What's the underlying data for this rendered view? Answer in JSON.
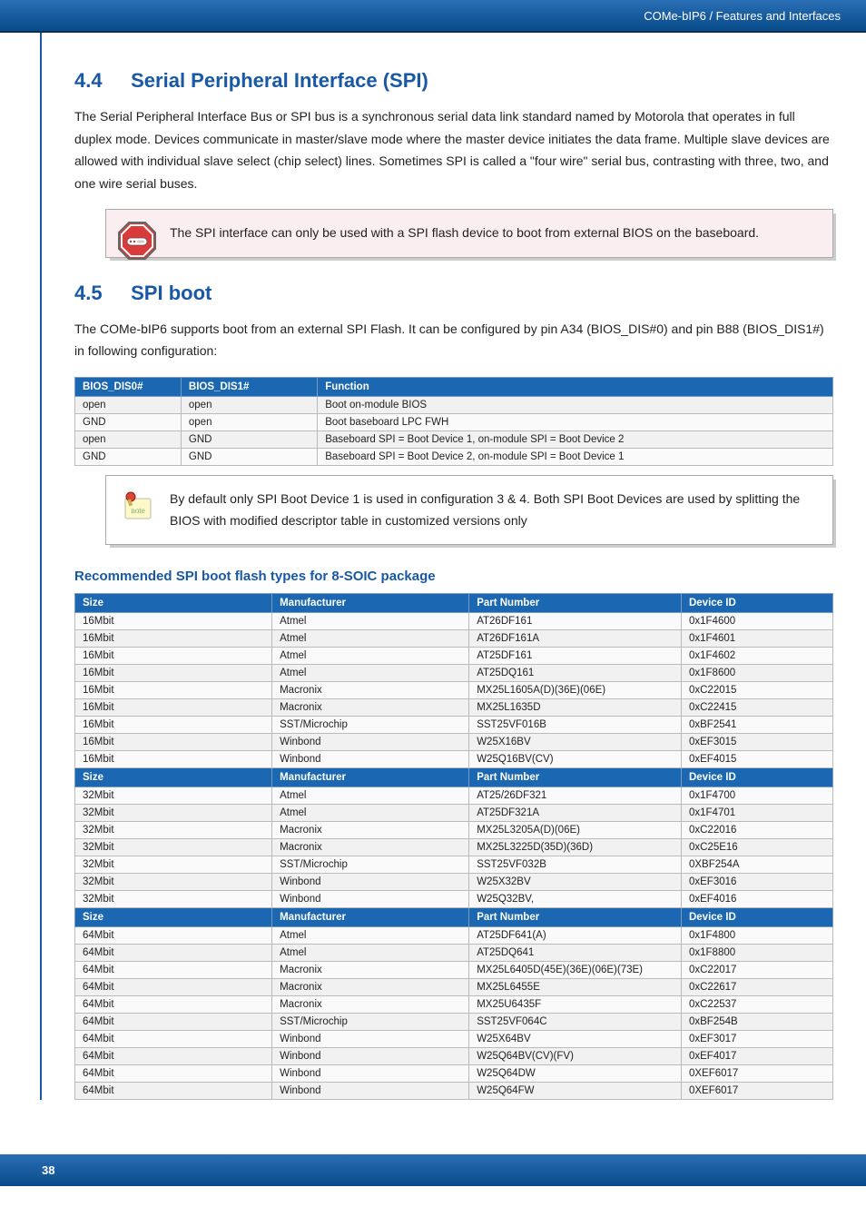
{
  "header_breadcrumb": "COMe-bIP6 / Features and Interfaces",
  "section_44": {
    "num": "4.4",
    "title": "Serial Peripheral Interface (SPI)",
    "body": "The Serial Peripheral Interface Bus or SPI bus is a synchronous serial data link standard named by Motorola that operates in full duplex mode. Devices communicate in master/slave mode where the master device initiates the data frame. Multiple slave devices are allowed with individual slave select (chip select) lines. Sometimes SPI is called a \"four wire\" serial bus, contrasting with three, two, and one wire serial buses.",
    "callout": "The SPI interface can only be used with a SPI flash device to boot from external BIOS on the baseboard."
  },
  "section_45": {
    "num": "4.5",
    "title": "SPI boot",
    "body": "The COMe-bIP6 supports boot from an external SPI Flash. It can be configured by pin A34 (BIOS_DIS#0) and pin B88 (BIOS_DIS1#) in following configuration:",
    "table_headers": [
      "BIOS_DIS0#",
      "BIOS_DIS1#",
      "Function"
    ],
    "rows": [
      [
        "open",
        "open",
        "Boot on-module BIOS"
      ],
      [
        "GND",
        "open",
        "Boot baseboard LPC FWH"
      ],
      [
        "open",
        "GND",
        "Baseboard SPI = Boot Device 1, on-module SPI = Boot Device 2"
      ],
      [
        "GND",
        "GND",
        "Baseboard SPI = Boot Device 2, on-module SPI = Boot Device 1"
      ]
    ],
    "note": "By default only SPI Boot Device 1 is used in configuration 3 & 4. Both SPI Boot Devices are used by splitting the BIOS with modified descriptor table in customized versions only"
  },
  "flash_section": {
    "title": "Recommended SPI boot flash types for 8-SOIC package",
    "headers": [
      "Size",
      "Manufacturer",
      "Part Number",
      "Device ID"
    ],
    "groups": [
      {
        "rows": [
          [
            "16Mbit",
            "Atmel",
            "AT26DF161",
            "0x1F4600"
          ],
          [
            "16Mbit",
            "Atmel",
            "AT26DF161A",
            "0x1F4601"
          ],
          [
            "16Mbit",
            "Atmel",
            "AT25DF161",
            "0x1F4602"
          ],
          [
            "16Mbit",
            "Atmel",
            "AT25DQ161",
            "0x1F8600"
          ],
          [
            "16Mbit",
            "Macronix",
            "MX25L1605A(D)(36E)(06E)",
            "0xC22015"
          ],
          [
            "16Mbit",
            "Macronix",
            "MX25L1635D",
            "0xC22415"
          ],
          [
            "16Mbit",
            "SST/Microchip",
            "SST25VF016B",
            "0xBF2541"
          ],
          [
            "16Mbit",
            "Winbond",
            "W25X16BV",
            "0xEF3015"
          ],
          [
            "16Mbit",
            "Winbond",
            "W25Q16BV(CV)",
            "0xEF4015"
          ]
        ]
      },
      {
        "rows": [
          [
            "32Mbit",
            "Atmel",
            "AT25/26DF321",
            "0x1F4700"
          ],
          [
            "32Mbit",
            "Atmel",
            "AT25DF321A",
            "0x1F4701"
          ],
          [
            "32Mbit",
            "Macronix",
            "MX25L3205A(D)(06E)",
            "0xC22016"
          ],
          [
            "32Mbit",
            "Macronix",
            "MX25L3225D(35D)(36D)",
            "0xC25E16"
          ],
          [
            "32Mbit",
            "SST/Microchip",
            "SST25VF032B",
            "0XBF254A"
          ],
          [
            "32Mbit",
            "Winbond",
            "W25X32BV",
            "0xEF3016"
          ],
          [
            "32Mbit",
            "Winbond",
            "W25Q32BV,",
            "0xEF4016"
          ]
        ]
      },
      {
        "rows": [
          [
            "64Mbit",
            "Atmel",
            "AT25DF641(A)",
            "0x1F4800"
          ],
          [
            "64Mbit",
            "Atmel",
            "AT25DQ641",
            "0x1F8800"
          ],
          [
            "64Mbit",
            "Macronix",
            "MX25L6405D(45E)(36E)(06E)(73E)",
            "0xC22017"
          ],
          [
            "64Mbit",
            "Macronix",
            "MX25L6455E",
            "0xC22617"
          ],
          [
            "64Mbit",
            "Macronix",
            "MX25U6435F",
            "0xC22537"
          ],
          [
            "64Mbit",
            "SST/Microchip",
            "SST25VF064C",
            "0xBF254B"
          ],
          [
            "64Mbit",
            "Winbond",
            "W25X64BV",
            "0xEF3017"
          ],
          [
            "64Mbit",
            "Winbond",
            "W25Q64BV(CV)(FV)",
            "0xEF4017"
          ],
          [
            "64Mbit",
            "Winbond",
            "W25Q64DW",
            "0XEF6017"
          ],
          [
            "64Mbit",
            "Winbond",
            "W25Q64FW",
            "0XEF6017"
          ]
        ]
      }
    ]
  },
  "page_number": "38"
}
